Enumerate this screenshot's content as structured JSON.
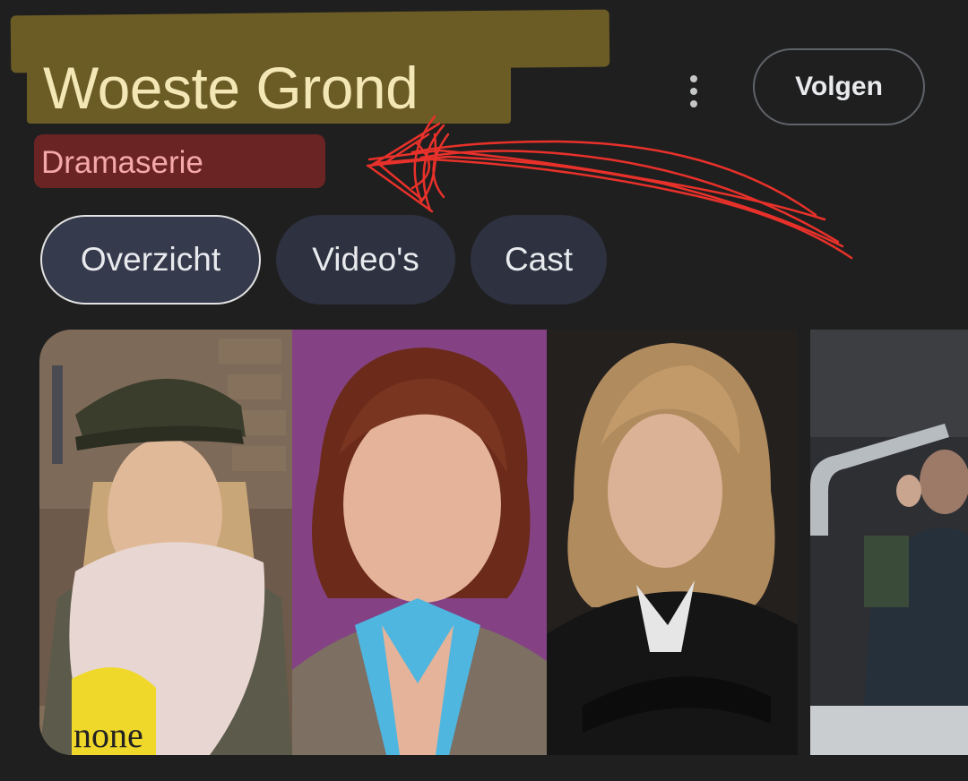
{
  "header": {
    "title": "Woeste Grond",
    "subtitle": "Dramaserie",
    "follow_label": "Volgen",
    "more_icon": "more-vert-icon"
  },
  "tabs": [
    {
      "label": "Overzicht",
      "active": true
    },
    {
      "label": "Video's",
      "active": false
    },
    {
      "label": "Cast",
      "active": false
    }
  ],
  "images": [
    {
      "subject": "woman-cap-scarf",
      "shirt_text": "none"
    },
    {
      "subject": "woman-red-hair-blue-collar"
    },
    {
      "subject": "woman-blonde-leather-jacket"
    },
    {
      "subject": "group-scene-partial"
    }
  ],
  "colors": {
    "background": "#1f1f1f",
    "title_highlight": "#6b5b25",
    "subtitle_highlight": "#6b2424",
    "annotation_red": "#e8312a"
  }
}
